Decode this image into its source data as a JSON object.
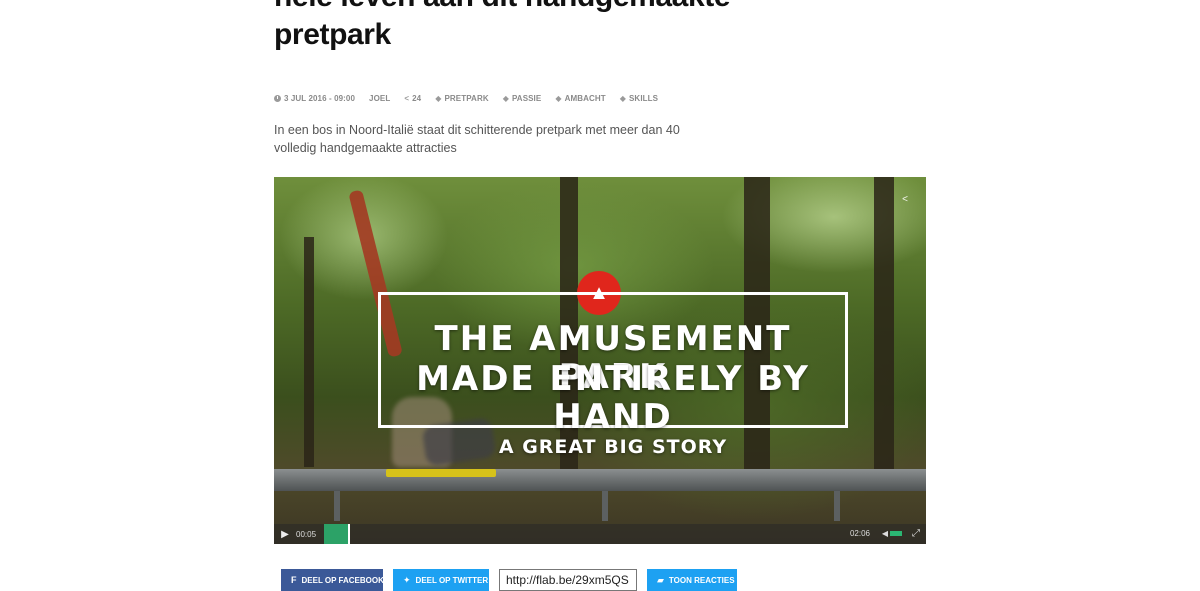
{
  "article": {
    "title_lines": [
      "hele leven aan dit handgemaakte",
      "pretpark"
    ],
    "meta": {
      "date": "3 JUL 2016 - 09:00",
      "author": "JOEL",
      "shares": "24",
      "tags": [
        "PRETPARK",
        "PASSIE",
        "AMBACHT",
        "SKILLS"
      ]
    },
    "lead": "In een bos in Noord-Italië staat dit schitterende pretpark met meer dan 40 volledig handgemaakte attracties"
  },
  "video": {
    "title_line1": "THE AMUSEMENT PARK",
    "title_line2": "MADE ENTIRELY BY HAND",
    "subtitle": "A GREAT BIG STORY",
    "logo_color": "#e0261c",
    "progress_color": "#2bb673",
    "time_current": "00:05",
    "time_total": "02:06",
    "icons": [
      "share-icon",
      "play-icon",
      "volume-icon",
      "fullscreen-icon"
    ]
  },
  "actions": {
    "facebook_label": "DEEL OP FACEBOOK",
    "twitter_label": "DEEL OP TWITTER",
    "short_url": "http://flab.be/29xm5QS",
    "reactions_label": "TOON REACTIES",
    "facebook_color": "#3b5998",
    "twitter_color": "#1da1f2"
  }
}
